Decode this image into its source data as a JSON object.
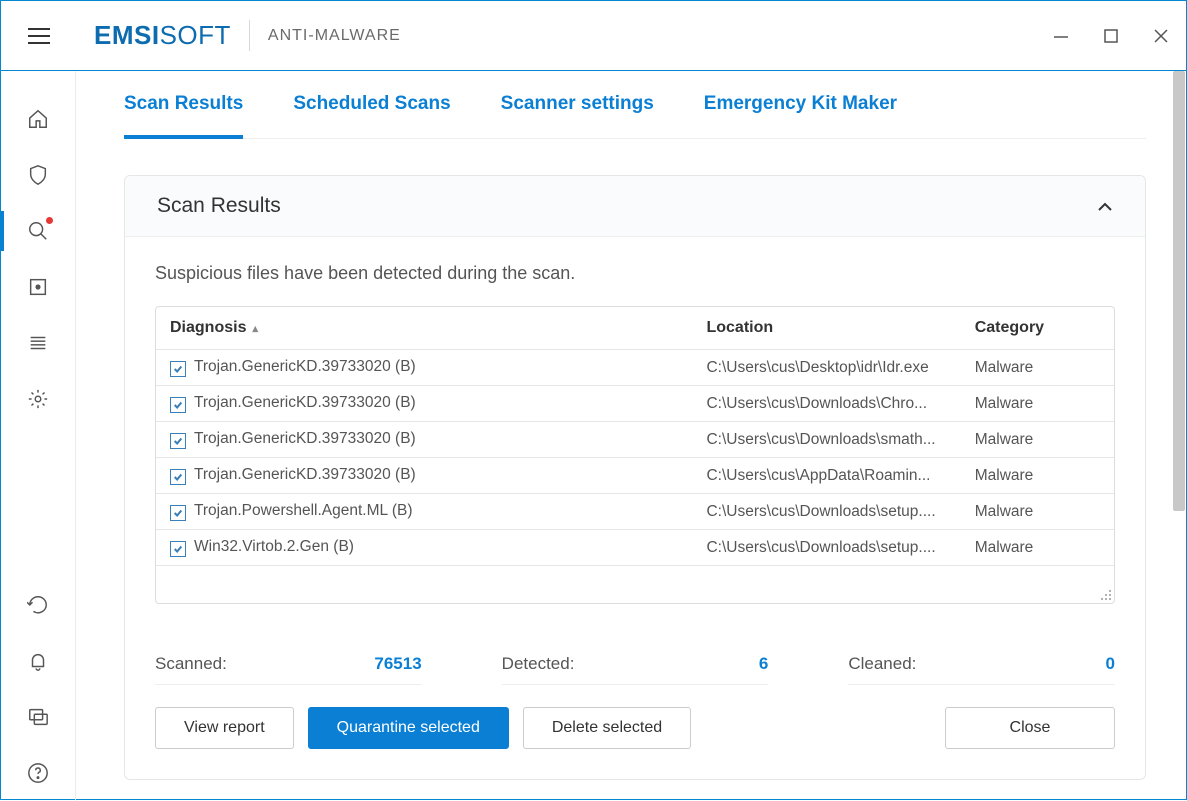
{
  "header": {
    "brand_strong": "EMSI",
    "brand_rest": "SOFT",
    "subtitle": "ANTI-MALWARE"
  },
  "sidebar": {
    "items": [
      {
        "name": "home-icon"
      },
      {
        "name": "shield-icon"
      },
      {
        "name": "scan-icon",
        "active": true,
        "dot": true
      },
      {
        "name": "quarantine-icon"
      },
      {
        "name": "logs-icon"
      },
      {
        "name": "settings-icon"
      }
    ],
    "bottom_items": [
      {
        "name": "sync-icon"
      },
      {
        "name": "bell-icon"
      },
      {
        "name": "chat-icon"
      },
      {
        "name": "help-icon"
      }
    ]
  },
  "tabs": [
    {
      "label": "Scan Results",
      "active": true
    },
    {
      "label": "Scheduled Scans"
    },
    {
      "label": "Scanner settings"
    },
    {
      "label": "Emergency Kit Maker"
    }
  ],
  "panel": {
    "title": "Scan Results",
    "message": "Suspicious files have been detected during the scan.",
    "columns": {
      "diagnosis": "Diagnosis",
      "location": "Location",
      "category": "Category"
    },
    "rows": [
      {
        "checked": true,
        "diagnosis": "Trojan.GenericKD.39733020 (B)",
        "location": "C:\\Users\\cus\\Desktop\\idr\\Idr.exe",
        "category": "Malware"
      },
      {
        "checked": true,
        "diagnosis": "Trojan.GenericKD.39733020 (B)",
        "location": "C:\\Users\\cus\\Downloads\\Chro...",
        "category": "Malware"
      },
      {
        "checked": true,
        "diagnosis": "Trojan.GenericKD.39733020 (B)",
        "location": "C:\\Users\\cus\\Downloads\\smath...",
        "category": "Malware"
      },
      {
        "checked": true,
        "diagnosis": "Trojan.GenericKD.39733020 (B)",
        "location": "C:\\Users\\cus\\AppData\\Roamin...",
        "category": "Malware"
      },
      {
        "checked": true,
        "diagnosis": "Trojan.Powershell.Agent.ML (B)",
        "location": "C:\\Users\\cus\\Downloads\\setup....",
        "category": "Malware"
      },
      {
        "checked": true,
        "diagnosis": "Win32.Virtob.2.Gen (B)",
        "location": "C:\\Users\\cus\\Downloads\\setup....",
        "category": "Malware"
      }
    ],
    "stats": {
      "scanned_label": "Scanned:",
      "scanned_value": "76513",
      "detected_label": "Detected:",
      "detected_value": "6",
      "cleaned_label": "Cleaned:",
      "cleaned_value": "0"
    },
    "buttons": {
      "view_report": "View report",
      "quarantine": "Quarantine selected",
      "delete": "Delete selected",
      "close": "Close"
    }
  }
}
